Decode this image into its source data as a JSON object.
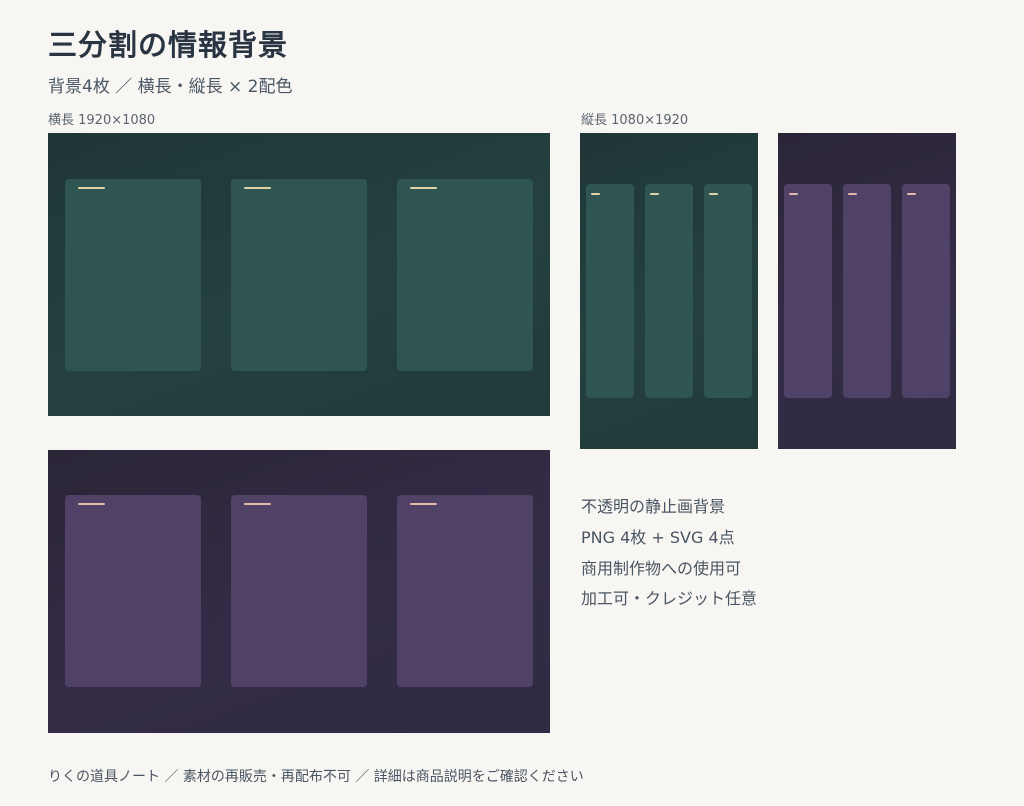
{
  "header": {
    "title": "三分割の情報背景",
    "subtitle": "背景4枚 ／ 横長・縦長 × 2配色"
  },
  "labels": {
    "landscape": "横長 1920×1080",
    "portrait": "縦長 1080×1920"
  },
  "colors": {
    "green_bg": "#213a3a",
    "green_panel": "#2f5552",
    "green_accent": "#e0d4a6",
    "purple_bg": "#302a42",
    "purple_panel": "#504266",
    "purple_accent": "#e4b9aa"
  },
  "features": [
    "不透明の静止画背景",
    "PNG 4枚 + SVG 4点",
    "商用制作物への使用可",
    "加工可・クレジット任意"
  ],
  "footer": "りくの道具ノート ／ 素材の再販売・再配布不可 ／ 詳細は商品説明をご確認ください"
}
